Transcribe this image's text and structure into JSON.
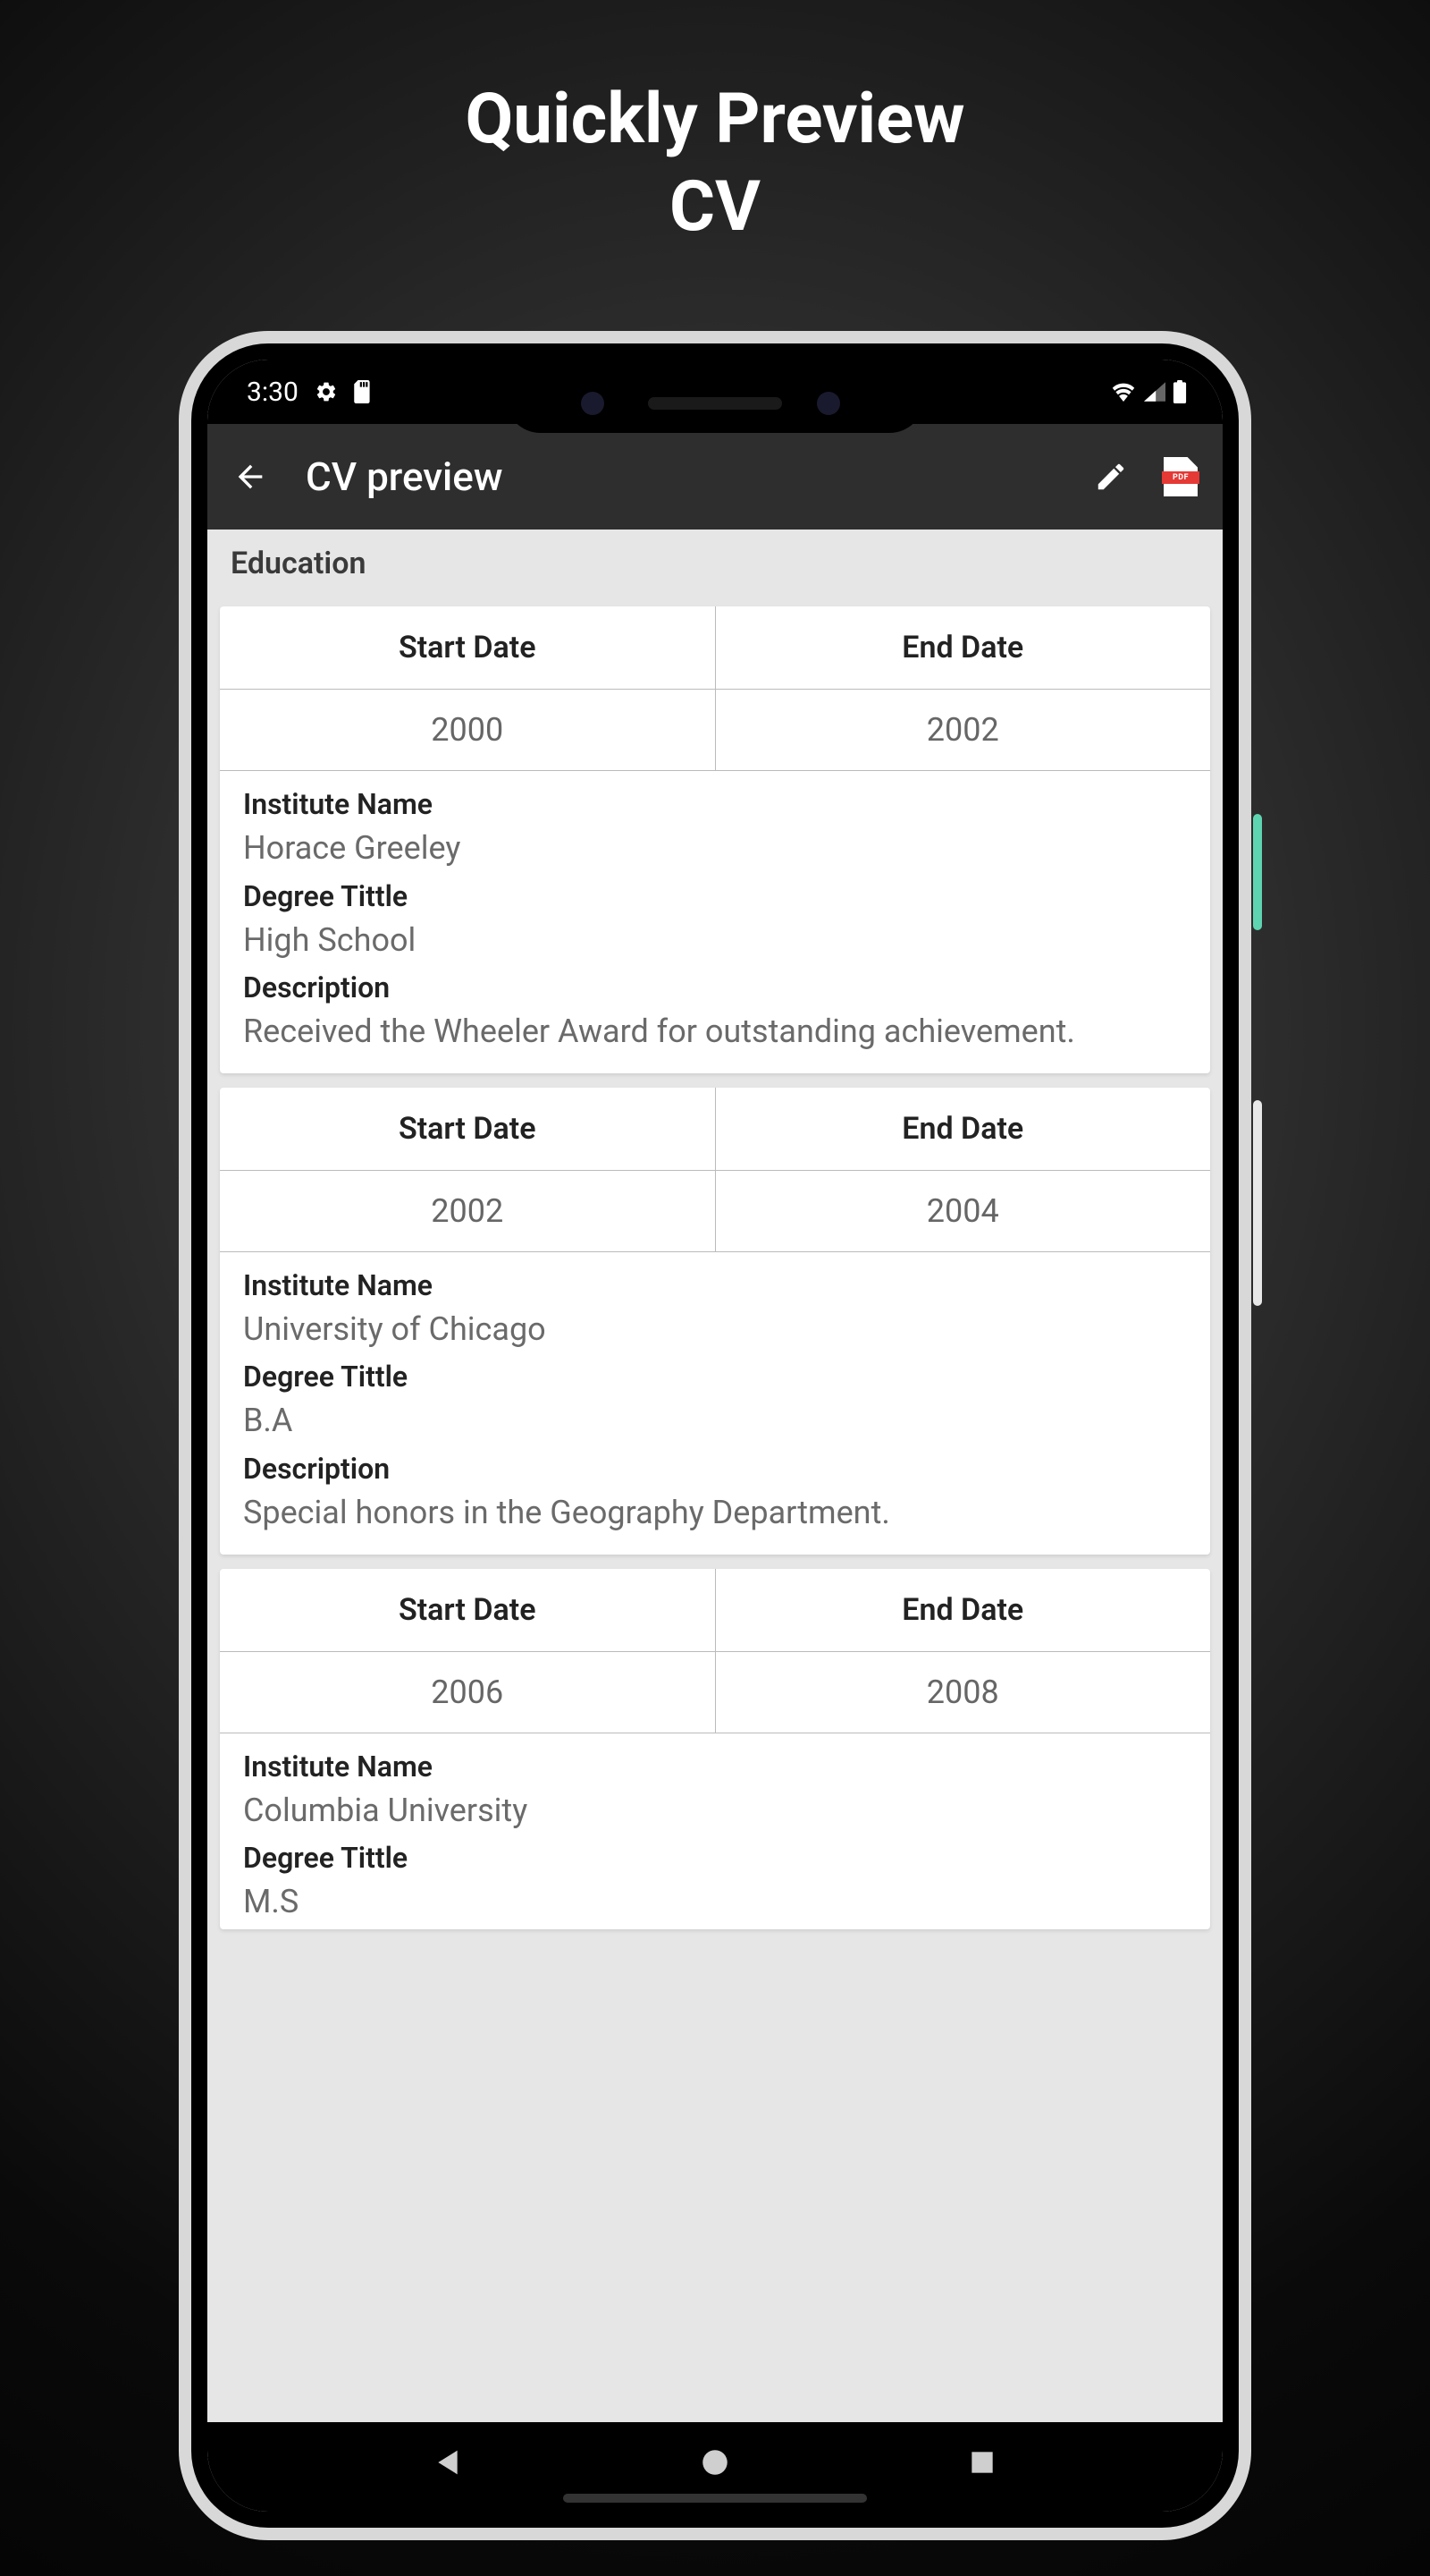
{
  "promo": {
    "line1": "Quickly Preview",
    "line2": "CV"
  },
  "statusbar": {
    "time": "3:30"
  },
  "appbar": {
    "title": "CV preview"
  },
  "section": {
    "title": "Education"
  },
  "labels": {
    "start_date": "Start Date",
    "end_date": "End Date",
    "institute": "Institute Name",
    "degree": "Degree Tittle",
    "description": "Description"
  },
  "education": [
    {
      "start": "2000",
      "end": "2002",
      "institute": "Horace Greeley",
      "degree": "High School",
      "description": "Received the Wheeler Award for outstanding achievement."
    },
    {
      "start": "2002",
      "end": "2004",
      "institute": "University of Chicago",
      "degree": "B.A",
      "description": "Special honors in the Geography Department."
    },
    {
      "start": "2006",
      "end": "2008",
      "institute": "Columbia University",
      "degree": "M.S",
      "description": ""
    }
  ],
  "pdf_label": "PDF"
}
